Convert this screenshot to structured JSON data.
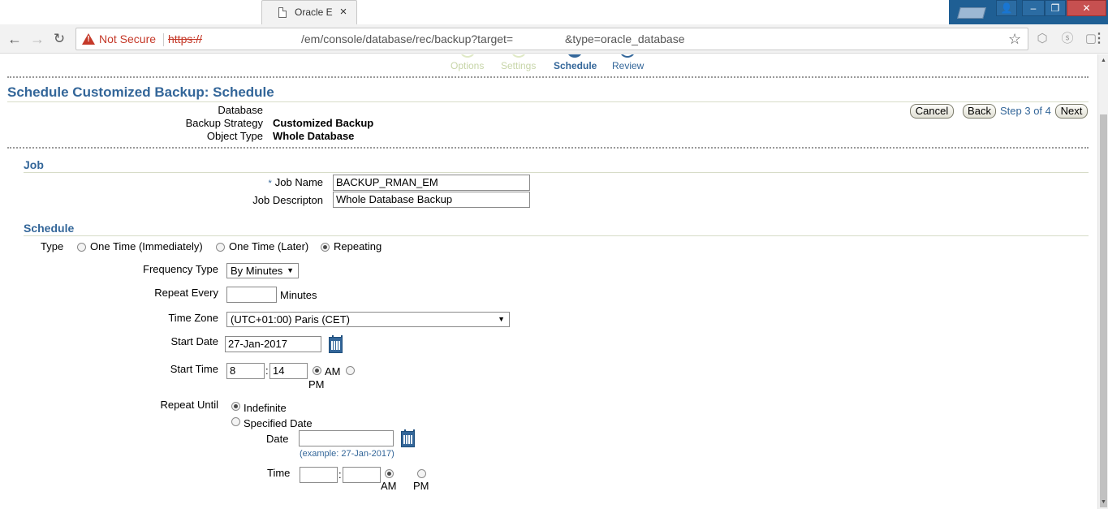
{
  "browser": {
    "tab_title": "Oracle E",
    "tab_close": "×",
    "security_label": "Not Secure",
    "url_scheme": "https://",
    "url_path": "/em/console/database/rec/backup?target=",
    "url_query": "&type=oracle_database"
  },
  "train": {
    "steps": [
      {
        "label": "Options"
      },
      {
        "label": "Settings"
      },
      {
        "label": "Schedule"
      },
      {
        "label": "Review"
      }
    ]
  },
  "page": {
    "title": "Schedule Customized Backup: Schedule"
  },
  "info": {
    "database_label": "Database",
    "database_value": "",
    "strategy_label": "Backup Strategy",
    "strategy_value": "Customized Backup",
    "object_type_label": "Object Type",
    "object_type_value": "Whole Database"
  },
  "actions": {
    "cancel": "Cancel",
    "back": "Back",
    "step": "Step 3 of 4",
    "next": "Next"
  },
  "job": {
    "header": "Job",
    "required_marker": "*",
    "name_label": "Job Name",
    "name_value": "BACKUP_RMAN_EM",
    "desc_label": "Job Descripton",
    "desc_value": "Whole Database Backup"
  },
  "schedule": {
    "header": "Schedule",
    "type_label": "Type",
    "type_options": [
      "One Time (Immediately)",
      "One Time (Later)",
      "Repeating"
    ],
    "type_selected": "Repeating",
    "frequency_label": "Frequency Type",
    "frequency_value": "By Minutes",
    "repeat_every_label": "Repeat Every",
    "repeat_every_value": "",
    "repeat_unit": "Minutes",
    "timezone_label": "Time Zone",
    "timezone_value": "(UTC+01:00) Paris (CET)",
    "start_date_label": "Start Date",
    "start_date_value": "27-Jan-2017",
    "start_time_label": "Start Time",
    "start_hour": "8",
    "start_minute": "14",
    "am_label": "AM",
    "pm_label": "PM",
    "start_ampm_selected": "AM",
    "repeat_until_label": "Repeat Until",
    "until_indefinite": "Indefinite",
    "until_specified": "Specified Date",
    "until_selected": "Indefinite",
    "date_label": "Date",
    "date_value": "",
    "date_hint": "(example: 27-Jan-2017)",
    "time_label": "Time",
    "time_hour": "",
    "time_minute": "",
    "until_ampm_selected": "AM"
  },
  "colors": {
    "accent": "#336699",
    "inactive_step": "#c7d5a8",
    "warning": "#c53929",
    "window_frame": "#1f5f94"
  }
}
